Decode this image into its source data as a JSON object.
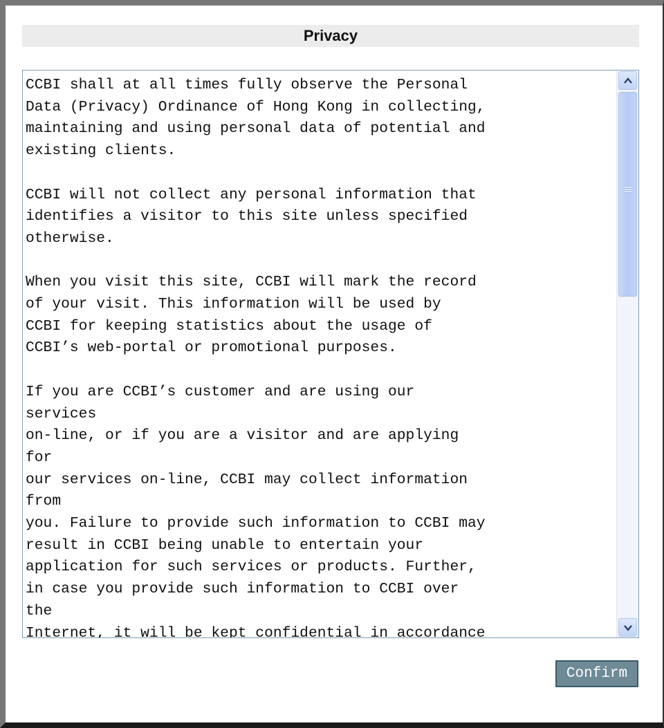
{
  "dialog": {
    "title": "Privacy",
    "confirm_label": "Confirm"
  },
  "privacy_text": {
    "lines": [
      "CCBI shall at all times fully observe the Personal",
      "Data (Privacy) Ordinance of Hong Kong in collecting,",
      "maintaining and using personal data of potential and",
      "existing clients.",
      "",
      "CCBI will not collect any personal information that",
      "identifies a visitor to this site unless specified",
      "otherwise.",
      "",
      "When you visit this site, CCBI will mark the record",
      "of your visit. This information will be used by",
      "CCBI for keeping statistics about the usage of",
      "CCBI’s web-portal or promotional purposes.",
      "",
      "If you are CCBI’s customer and are using our",
      "services",
      "on-line, or if you are a visitor and are applying",
      "for",
      "our services on-line, CCBI may collect information",
      "from",
      "you. Failure to provide such information to CCBI may",
      "result in CCBI being unable to entertain your",
      "application for such services or products. Further,",
      "in case you provide such information to CCBI over",
      "the",
      "Internet, it will be kept confidential in accordance"
    ]
  },
  "icons": {
    "scroll_up": "arrow-up-icon",
    "scroll_down": "arrow-down-icon"
  },
  "colors": {
    "button_bg": "#6d8a96",
    "scrollbar_thumb": "#b6cbf4",
    "title_bg": "#ececec"
  }
}
